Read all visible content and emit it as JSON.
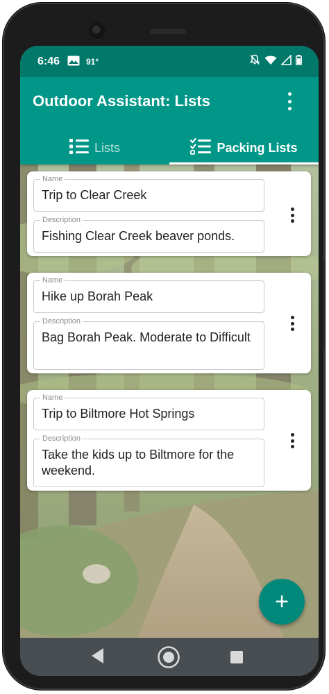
{
  "status_bar": {
    "time": "6:46",
    "temperature": "91°",
    "icons": [
      "image-icon",
      "notifications-muted-icon",
      "wifi-icon",
      "cell-signal-icon",
      "battery-icon"
    ]
  },
  "app_bar": {
    "title": "Outdoor Assistant: Lists",
    "menu_icon": "more-vert-icon"
  },
  "tabs": [
    {
      "label": "Lists",
      "icon": "list-icon",
      "selected": false
    },
    {
      "label": "Packing Lists",
      "icon": "checklist-icon",
      "selected": true
    }
  ],
  "cards": [
    {
      "name_label": "Name",
      "name_value": "Trip to Clear Creek",
      "description_label": "Description",
      "description_value": "Fishing Clear Creek beaver ponds."
    },
    {
      "name_label": "Name",
      "name_value": "Hike up Borah Peak",
      "description_label": "Description",
      "description_value": "Bag Borah Peak. Moderate to Difficult"
    },
    {
      "name_label": "Name",
      "name_value": "Trip to Biltmore Hot Springs",
      "description_label": "Description",
      "description_value": "Take the kids up to Biltmore for the weekend."
    }
  ],
  "fab": {
    "label": "+",
    "icon": "add-icon"
  },
  "nav_bar": {
    "icons": [
      "back-icon",
      "home-icon",
      "recents-icon"
    ]
  },
  "colors": {
    "status_bar": "#00796b",
    "app_bar": "#009688",
    "fab": "#00897b",
    "nav_bar": "#474d51"
  }
}
